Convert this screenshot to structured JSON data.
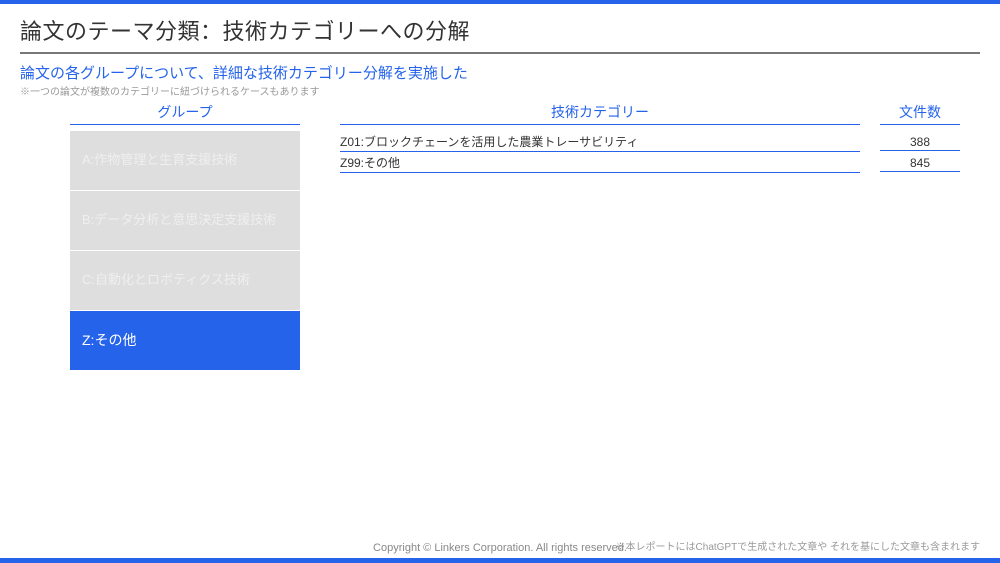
{
  "title": "論文のテーマ分類：技術カテゴリーへの分解",
  "subtitle": "論文の各グループについて、詳細な技術カテゴリー分解を実施した",
  "note": "※一つの論文が複数のカテゴリーに紐づけられるケースもあります",
  "headers": {
    "group": "グループ",
    "tech": "技術カテゴリー",
    "count": "文件数"
  },
  "sidebar": {
    "a": "A:作物管理と生育支援技術",
    "b": "B:データ分析と意思決定支援技術",
    "c": "C:自動化とロボティクス技術",
    "z": "Z:その他"
  },
  "rows": [
    {
      "tech": "Z01:ブロックチェーンを活用した農業トレーサビリティ",
      "count": "388"
    },
    {
      "tech": "Z99:その他",
      "count": "845"
    }
  ],
  "copyright": "Copyright © Linkers Corporation. All rights reserved.",
  "footnote": "※本レポートにはChatGPTで生成された文章や それを基にした文章も含まれます"
}
